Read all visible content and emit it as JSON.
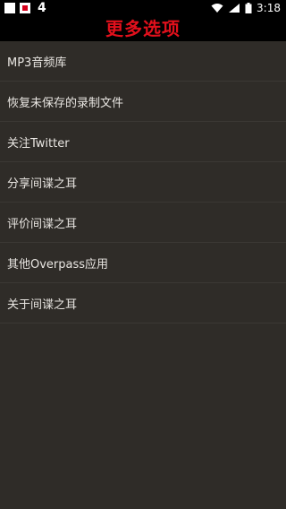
{
  "status_bar": {
    "notification_count": "4",
    "time": "3:18"
  },
  "header": {
    "title": "更多选项"
  },
  "menu": {
    "items": [
      {
        "label": "MP3音频库"
      },
      {
        "label": "恢复未保存的录制文件"
      },
      {
        "label": "关注Twitter"
      },
      {
        "label": "分享间谍之耳"
      },
      {
        "label": "评价间谍之耳"
      },
      {
        "label": "其他Overpass应用"
      },
      {
        "label": "关于间谍之耳"
      }
    ]
  },
  "colors": {
    "title_red": "#e2101c",
    "background": "#2f2c28",
    "bar_black": "#000000"
  }
}
